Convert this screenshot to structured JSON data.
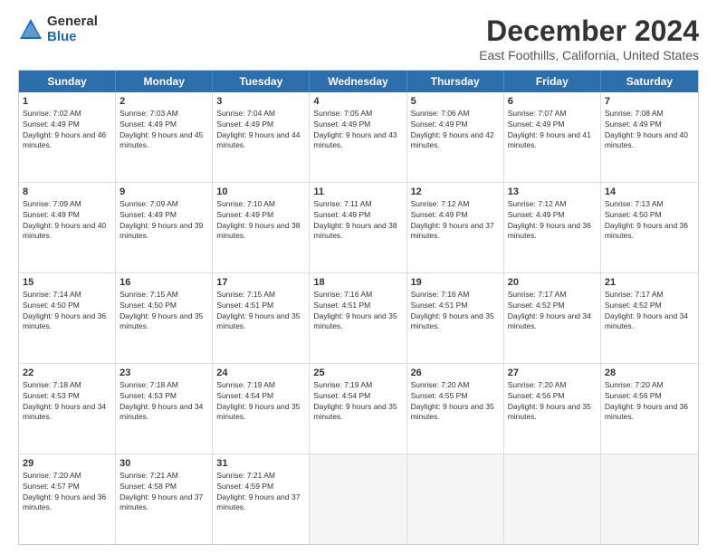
{
  "logo": {
    "general": "General",
    "blue": "Blue"
  },
  "title": "December 2024",
  "subtitle": "East Foothills, California, United States",
  "days": [
    "Sunday",
    "Monday",
    "Tuesday",
    "Wednesday",
    "Thursday",
    "Friday",
    "Saturday"
  ],
  "weeks": [
    [
      {
        "day": "1",
        "sunrise": "Sunrise: 7:02 AM",
        "sunset": "Sunset: 4:49 PM",
        "daylight": "Daylight: 9 hours and 46 minutes."
      },
      {
        "day": "2",
        "sunrise": "Sunrise: 7:03 AM",
        "sunset": "Sunset: 4:49 PM",
        "daylight": "Daylight: 9 hours and 45 minutes."
      },
      {
        "day": "3",
        "sunrise": "Sunrise: 7:04 AM",
        "sunset": "Sunset: 4:49 PM",
        "daylight": "Daylight: 9 hours and 44 minutes."
      },
      {
        "day": "4",
        "sunrise": "Sunrise: 7:05 AM",
        "sunset": "Sunset: 4:49 PM",
        "daylight": "Daylight: 9 hours and 43 minutes."
      },
      {
        "day": "5",
        "sunrise": "Sunrise: 7:06 AM",
        "sunset": "Sunset: 4:49 PM",
        "daylight": "Daylight: 9 hours and 42 minutes."
      },
      {
        "day": "6",
        "sunrise": "Sunrise: 7:07 AM",
        "sunset": "Sunset: 4:49 PM",
        "daylight": "Daylight: 9 hours and 41 minutes."
      },
      {
        "day": "7",
        "sunrise": "Sunrise: 7:08 AM",
        "sunset": "Sunset: 4:49 PM",
        "daylight": "Daylight: 9 hours and 40 minutes."
      }
    ],
    [
      {
        "day": "8",
        "sunrise": "Sunrise: 7:09 AM",
        "sunset": "Sunset: 4:49 PM",
        "daylight": "Daylight: 9 hours and 40 minutes."
      },
      {
        "day": "9",
        "sunrise": "Sunrise: 7:09 AM",
        "sunset": "Sunset: 4:49 PM",
        "daylight": "Daylight: 9 hours and 39 minutes."
      },
      {
        "day": "10",
        "sunrise": "Sunrise: 7:10 AM",
        "sunset": "Sunset: 4:49 PM",
        "daylight": "Daylight: 9 hours and 38 minutes."
      },
      {
        "day": "11",
        "sunrise": "Sunrise: 7:11 AM",
        "sunset": "Sunset: 4:49 PM",
        "daylight": "Daylight: 9 hours and 38 minutes."
      },
      {
        "day": "12",
        "sunrise": "Sunrise: 7:12 AM",
        "sunset": "Sunset: 4:49 PM",
        "daylight": "Daylight: 9 hours and 37 minutes."
      },
      {
        "day": "13",
        "sunrise": "Sunrise: 7:12 AM",
        "sunset": "Sunset: 4:49 PM",
        "daylight": "Daylight: 9 hours and 36 minutes."
      },
      {
        "day": "14",
        "sunrise": "Sunrise: 7:13 AM",
        "sunset": "Sunset: 4:50 PM",
        "daylight": "Daylight: 9 hours and 36 minutes."
      }
    ],
    [
      {
        "day": "15",
        "sunrise": "Sunrise: 7:14 AM",
        "sunset": "Sunset: 4:50 PM",
        "daylight": "Daylight: 9 hours and 36 minutes."
      },
      {
        "day": "16",
        "sunrise": "Sunrise: 7:15 AM",
        "sunset": "Sunset: 4:50 PM",
        "daylight": "Daylight: 9 hours and 35 minutes."
      },
      {
        "day": "17",
        "sunrise": "Sunrise: 7:15 AM",
        "sunset": "Sunset: 4:51 PM",
        "daylight": "Daylight: 9 hours and 35 minutes."
      },
      {
        "day": "18",
        "sunrise": "Sunrise: 7:16 AM",
        "sunset": "Sunset: 4:51 PM",
        "daylight": "Daylight: 9 hours and 35 minutes."
      },
      {
        "day": "19",
        "sunrise": "Sunrise: 7:16 AM",
        "sunset": "Sunset: 4:51 PM",
        "daylight": "Daylight: 9 hours and 35 minutes."
      },
      {
        "day": "20",
        "sunrise": "Sunrise: 7:17 AM",
        "sunset": "Sunset: 4:52 PM",
        "daylight": "Daylight: 9 hours and 34 minutes."
      },
      {
        "day": "21",
        "sunrise": "Sunrise: 7:17 AM",
        "sunset": "Sunset: 4:52 PM",
        "daylight": "Daylight: 9 hours and 34 minutes."
      }
    ],
    [
      {
        "day": "22",
        "sunrise": "Sunrise: 7:18 AM",
        "sunset": "Sunset: 4:53 PM",
        "daylight": "Daylight: 9 hours and 34 minutes."
      },
      {
        "day": "23",
        "sunrise": "Sunrise: 7:18 AM",
        "sunset": "Sunset: 4:53 PM",
        "daylight": "Daylight: 9 hours and 34 minutes."
      },
      {
        "day": "24",
        "sunrise": "Sunrise: 7:19 AM",
        "sunset": "Sunset: 4:54 PM",
        "daylight": "Daylight: 9 hours and 35 minutes."
      },
      {
        "day": "25",
        "sunrise": "Sunrise: 7:19 AM",
        "sunset": "Sunset: 4:54 PM",
        "daylight": "Daylight: 9 hours and 35 minutes."
      },
      {
        "day": "26",
        "sunrise": "Sunrise: 7:20 AM",
        "sunset": "Sunset: 4:55 PM",
        "daylight": "Daylight: 9 hours and 35 minutes."
      },
      {
        "day": "27",
        "sunrise": "Sunrise: 7:20 AM",
        "sunset": "Sunset: 4:56 PM",
        "daylight": "Daylight: 9 hours and 35 minutes."
      },
      {
        "day": "28",
        "sunrise": "Sunrise: 7:20 AM",
        "sunset": "Sunset: 4:56 PM",
        "daylight": "Daylight: 9 hours and 36 minutes."
      }
    ],
    [
      {
        "day": "29",
        "sunrise": "Sunrise: 7:20 AM",
        "sunset": "Sunset: 4:57 PM",
        "daylight": "Daylight: 9 hours and 36 minutes."
      },
      {
        "day": "30",
        "sunrise": "Sunrise: 7:21 AM",
        "sunset": "Sunset: 4:58 PM",
        "daylight": "Daylight: 9 hours and 37 minutes."
      },
      {
        "day": "31",
        "sunrise": "Sunrise: 7:21 AM",
        "sunset": "Sunset: 4:59 PM",
        "daylight": "Daylight: 9 hours and 37 minutes."
      },
      null,
      null,
      null,
      null
    ]
  ]
}
